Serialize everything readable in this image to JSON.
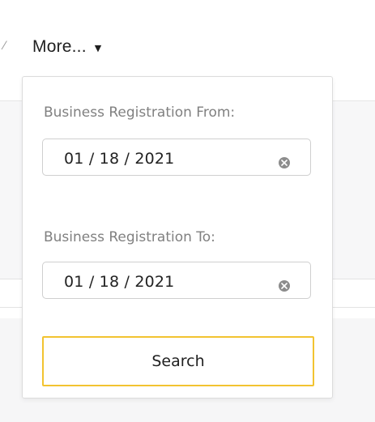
{
  "menu": {
    "more_label": "More...",
    "caret_icon": "caret-down-icon"
  },
  "filters": {
    "from": {
      "label": "Business Registration From:",
      "value": "01 / 18 / 2021",
      "clear_icon": "clear-icon"
    },
    "to": {
      "label": "Business Registration To:",
      "value": "01 / 18 / 2021",
      "clear_icon": "clear-icon"
    },
    "search_label": "Search"
  },
  "colors": {
    "accent": "#f2c330",
    "label_text": "#808080",
    "clear_icon": "#8c8c8c"
  }
}
